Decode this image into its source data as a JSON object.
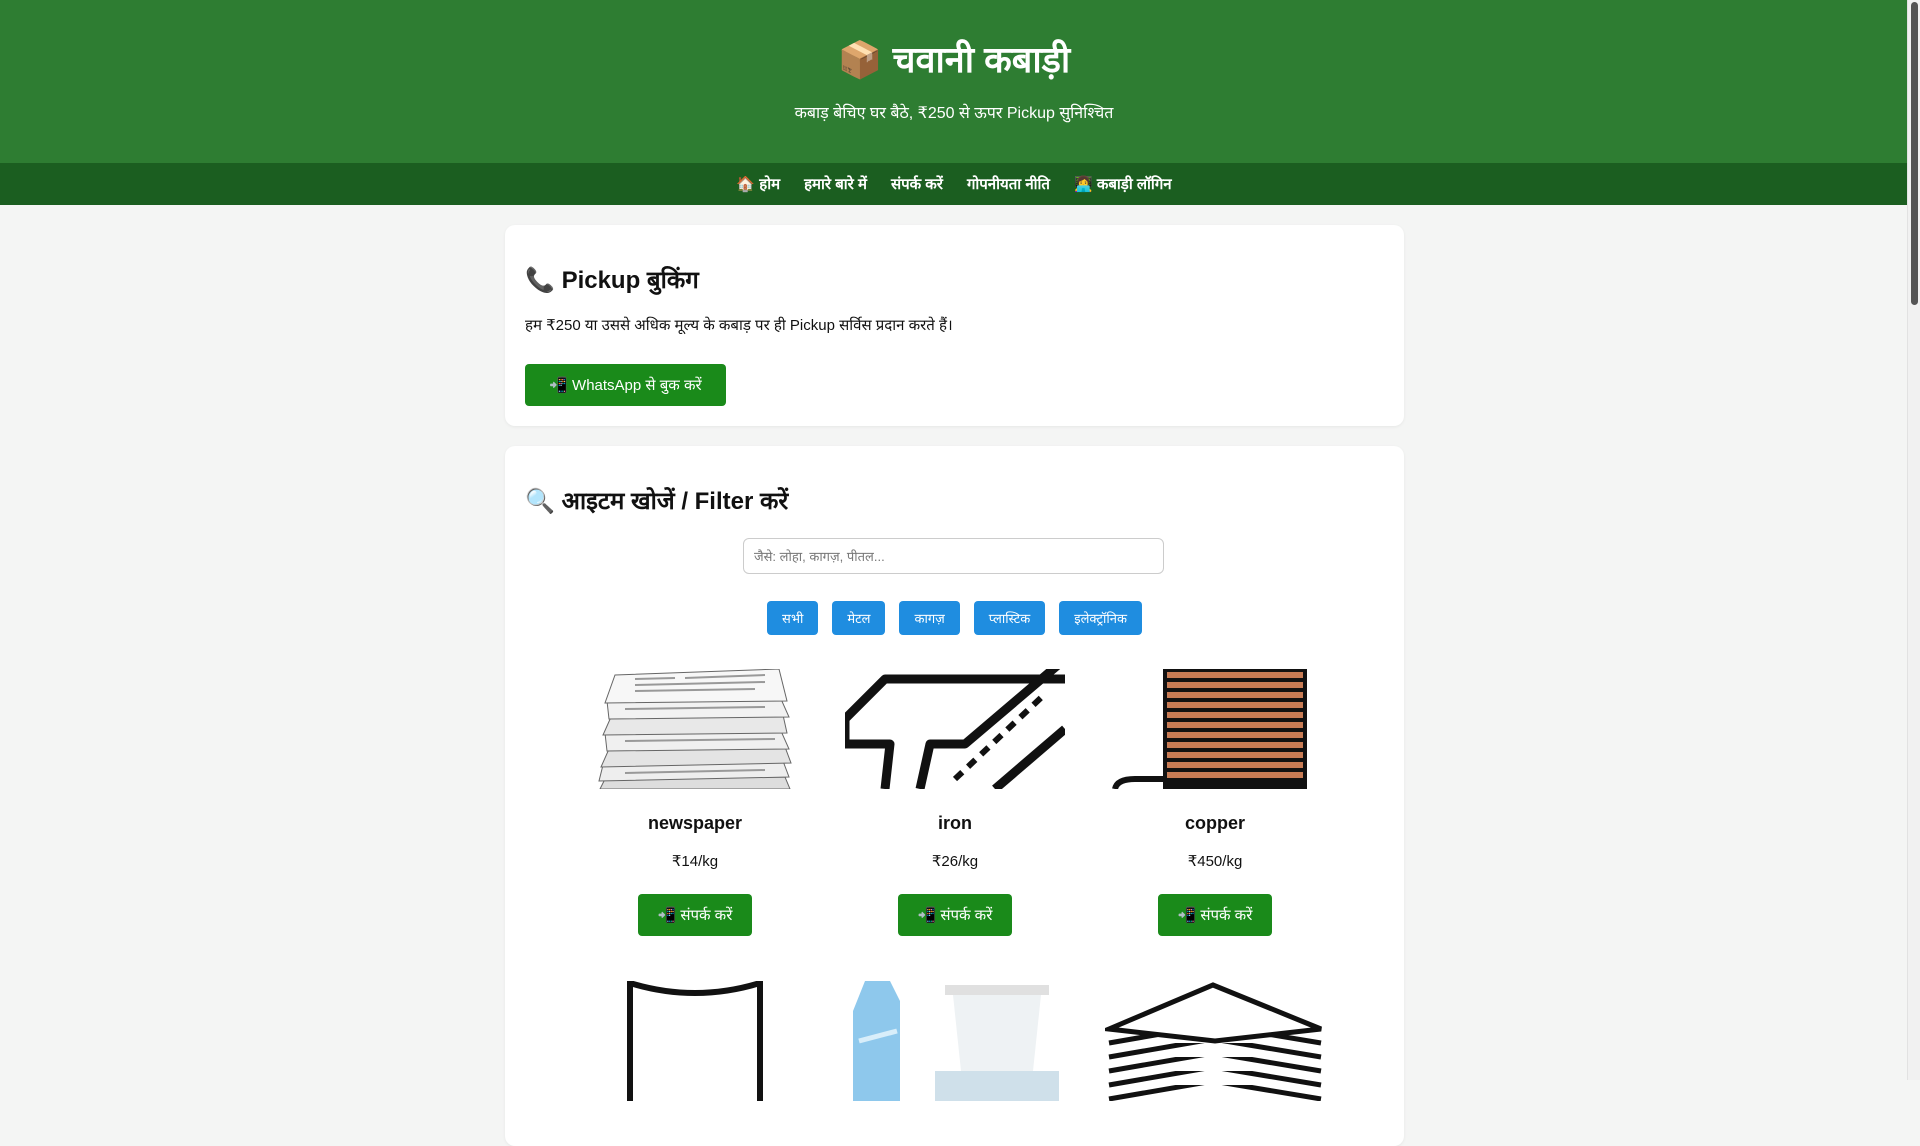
{
  "header": {
    "logo_icon": "📦",
    "title": "चवानी कबाड़ी",
    "subtitle": "कबाड़ बेचिए घर बैठे, ₹250 से ऊपर Pickup सुनिश्चित"
  },
  "nav": {
    "home_icon": "🏠",
    "home": "होम",
    "about": "हमारे बारे में",
    "contact": "संपर्क करें",
    "privacy": "गोपनीयता नीति",
    "login_icon": "👩‍💻",
    "login": "कबाड़ी लॉगिन"
  },
  "booking": {
    "icon": "📞",
    "title": "Pickup बुकिंग",
    "description": "हम ₹250 या उससे अधिक मूल्य के कबाड़ पर ही Pickup सर्विस प्रदान करते हैं।",
    "button_icon": "📲",
    "button_label": "WhatsApp से बुक करें"
  },
  "filter_section": {
    "icon": "🔍",
    "title": "आइटम खोजें / Filter करें",
    "search_placeholder": "जैसे: लोहा, कागज़, पीतल...",
    "search_value": "",
    "filters": [
      "सभी",
      "मेटल",
      "कागज़",
      "प्लास्टिक",
      "इलेक्ट्रॉनिक"
    ]
  },
  "items": [
    {
      "name": "newspaper",
      "price": "₹14/kg",
      "contact_icon": "📲",
      "contact_label": "संपर्क करें"
    },
    {
      "name": "iron",
      "price": "₹26/kg",
      "contact_icon": "📲",
      "contact_label": "संपर्क करें"
    },
    {
      "name": "copper",
      "price": "₹450/kg",
      "contact_icon": "📲",
      "contact_label": "संपर्क करें"
    }
  ],
  "colors": {
    "header": "#2e7d32",
    "nav": "#1b5e20",
    "primary_button": "#1a8a1a",
    "filter_button": "#1f8de0"
  }
}
